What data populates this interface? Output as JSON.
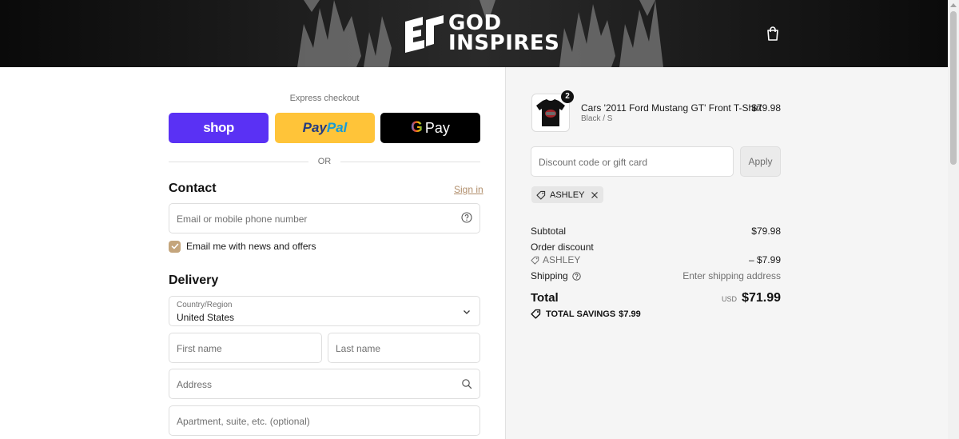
{
  "brand": {
    "line1": "GOD",
    "line2": "INSPIRES"
  },
  "express": {
    "label": "Express checkout",
    "shop_label": "shop",
    "paypal_part1": "Pay",
    "paypal_part2": "Pal",
    "gpay_g": "G",
    "gpay_label": "Pay",
    "or_label": "OR"
  },
  "contact": {
    "title": "Contact",
    "sign_in": "Sign in",
    "email_placeholder": "Email or mobile phone number",
    "newsletter_label": "Email me with news and offers",
    "newsletter_checked": true
  },
  "delivery": {
    "title": "Delivery",
    "country_label": "Country/Region",
    "country_value": "United States",
    "first_name_placeholder": "First name",
    "last_name_placeholder": "Last name",
    "address_placeholder": "Address",
    "apartment_placeholder": "Apartment, suite, etc. (optional)"
  },
  "summary": {
    "item": {
      "title": "Cars '2011 Ford Mustang GT' Front T-Shirt",
      "variant": "Black / S",
      "price": "$79.98",
      "quantity": "2"
    },
    "discount_placeholder": "Discount code or gift card",
    "apply_label": "Apply",
    "applied_code": "ASHLEY",
    "subtotal_label": "Subtotal",
    "subtotal_value": "$79.98",
    "order_discount_label": "Order discount",
    "order_discount_code": "ASHLEY",
    "order_discount_value": "– $7.99",
    "shipping_label": "Shipping",
    "shipping_value": "Enter shipping address",
    "total_label": "Total",
    "total_currency": "USD",
    "total_value": "$71.99",
    "savings_label": "TOTAL SAVINGS",
    "savings_value": "$7.99"
  },
  "colors": {
    "shop": "#5a31f4",
    "paypal": "#ffc439",
    "gpay": "#000000",
    "accent": "#c4a57c"
  }
}
